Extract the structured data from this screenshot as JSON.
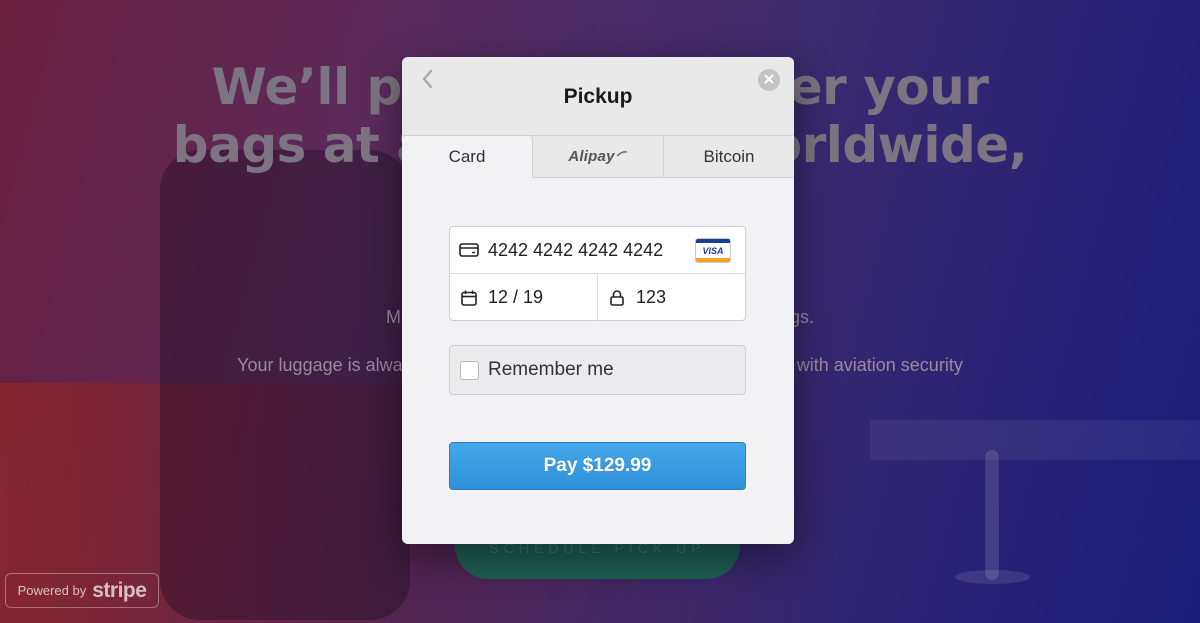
{
  "background": {
    "hero_title_line1": "We’ll pi                    ver your",
    "hero_title_line2": "bags at a                    orldwide,",
    "paragraph1": "Make y                                                               r bags.",
    "paragraph2": "Your luggage is always seale                                                        pliant with aviation security",
    "schedule_button": "SCHEDULE PICK UP",
    "powered_by_label": "Powered by",
    "powered_by_brand": "stripe"
  },
  "modal": {
    "title": "Pickup",
    "back_icon": "chevron-left-icon",
    "close_icon": "close-circle-icon",
    "tabs": [
      {
        "label": "Card",
        "active": true
      },
      {
        "label": "Alipay",
        "active": false
      },
      {
        "label": "Bitcoin",
        "active": false
      }
    ],
    "card": {
      "number": "4242 4242 4242 4242",
      "brand": "VISA",
      "expiry": "12 / 19",
      "cvc": "123"
    },
    "remember_me": {
      "label": "Remember me",
      "checked": false
    },
    "pay_button": "Pay $129.99"
  },
  "colors": {
    "pay_button": "#3b9be2",
    "modal_bg": "#f2f2f4",
    "header_bg": "#e9e9ea"
  }
}
